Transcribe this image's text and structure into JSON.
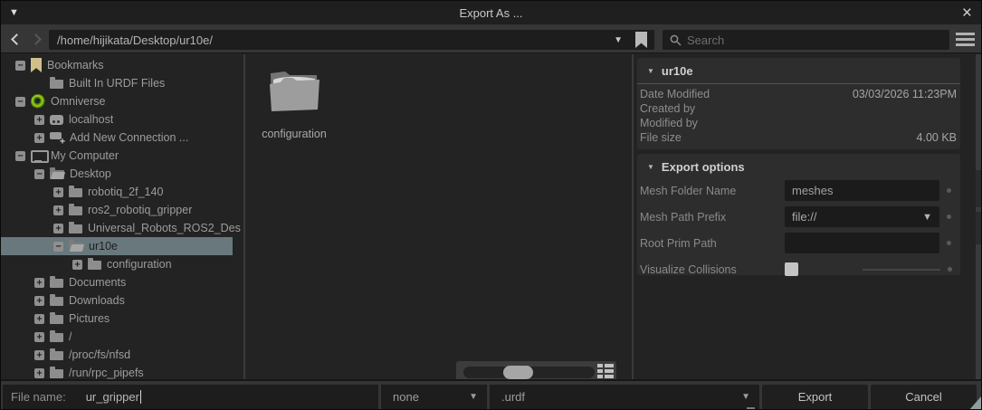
{
  "window": {
    "title": "Export As ..."
  },
  "icons": {
    "window_menu": "▼",
    "close": "×",
    "path_dropdown": "▼",
    "combo_dropdown": "▼",
    "footer_dropdown": "▼",
    "section_collapse": "▼",
    "back": "chevron-left",
    "forward": "chevron-right",
    "search": "magnifier",
    "bookmark": "bookmark-ribbon",
    "menu": "hamburger",
    "view_mode": "grid"
  },
  "toolbar": {
    "path_value": "/home/hijikata/Desktop/ur10e/",
    "search_placeholder": "Search"
  },
  "tree": {
    "items": [
      {
        "label": "Bookmarks",
        "level": 0,
        "expander": "minus",
        "icon": "bookmark",
        "selected": false
      },
      {
        "label": "Built In URDF Files",
        "level": 1,
        "expander": "none",
        "icon": "folder",
        "selected": false
      },
      {
        "label": "Omniverse",
        "level": 0,
        "expander": "minus",
        "icon": "omniverse",
        "selected": false
      },
      {
        "label": "localhost",
        "level": 1,
        "expander": "plus",
        "icon": "server",
        "selected": false
      },
      {
        "label": "Add New Connection ...",
        "level": 1,
        "expander": "plus",
        "icon": "server-add",
        "selected": false
      },
      {
        "label": "My Computer",
        "level": 0,
        "expander": "minus",
        "icon": "computer",
        "selected": false
      },
      {
        "label": "Desktop",
        "level": 1,
        "expander": "minus",
        "icon": "folder-open",
        "selected": false
      },
      {
        "label": "robotiq_2f_140",
        "level": 2,
        "expander": "plus",
        "icon": "folder",
        "selected": false
      },
      {
        "label": "ros2_robotiq_gripper",
        "level": 2,
        "expander": "plus",
        "icon": "folder",
        "selected": false
      },
      {
        "label": "Universal_Robots_ROS2_Des",
        "level": 2,
        "expander": "plus",
        "icon": "folder",
        "selected": false
      },
      {
        "label": "ur10e",
        "level": 2,
        "expander": "minus",
        "icon": "folder-open",
        "selected": true
      },
      {
        "label": "configuration",
        "level": 3,
        "expander": "plus",
        "icon": "folder",
        "selected": false
      },
      {
        "label": "Documents",
        "level": 1,
        "expander": "plus",
        "icon": "folder",
        "selected": false
      },
      {
        "label": "Downloads",
        "level": 1,
        "expander": "plus",
        "icon": "folder",
        "selected": false
      },
      {
        "label": "Pictures",
        "level": 1,
        "expander": "plus",
        "icon": "folder",
        "selected": false
      },
      {
        "label": "/",
        "level": 1,
        "expander": "plus",
        "icon": "folder",
        "selected": false
      },
      {
        "label": "/proc/fs/nfsd",
        "level": 1,
        "expander": "plus",
        "icon": "folder",
        "selected": false
      },
      {
        "label": "/run/rpc_pipefs",
        "level": 1,
        "expander": "plus",
        "icon": "folder",
        "selected": false
      }
    ]
  },
  "files": {
    "items": [
      {
        "name": "configuration",
        "type": "folder"
      }
    ]
  },
  "details": {
    "title": "ur10e",
    "rows": [
      {
        "label": "Date Modified",
        "value": "03/03/2026 11:23PM"
      },
      {
        "label": "Created by",
        "value": ""
      },
      {
        "label": "Modified by",
        "value": ""
      },
      {
        "label": "File size",
        "value": "4.00 KB"
      }
    ]
  },
  "export_options": {
    "title": "Export options",
    "mesh_folder_name": {
      "label": "Mesh Folder Name",
      "value": "meshes"
    },
    "mesh_path_prefix": {
      "label": "Mesh Path Prefix",
      "value": "file://"
    },
    "root_prim_path": {
      "label": "Root Prim Path",
      "value": ""
    },
    "visualize_collisions": {
      "label": "Visualize Collisions",
      "checked": false
    }
  },
  "footer": {
    "file_name_label": "File name:",
    "file_name_value": "ur_gripper",
    "options_value": "none",
    "extension_value": ".urdf",
    "export_label": "Export",
    "cancel_label": "Cancel"
  },
  "colors": {
    "selection_row": "#68787c",
    "panel_bg": "#232323",
    "section_bg": "#2d2d2d",
    "input_bg": "#1d1d1d",
    "toolbar_bg": "#363636",
    "omniverse_green": "#8ec51e",
    "bookmark_tan": "#cfc08a"
  }
}
